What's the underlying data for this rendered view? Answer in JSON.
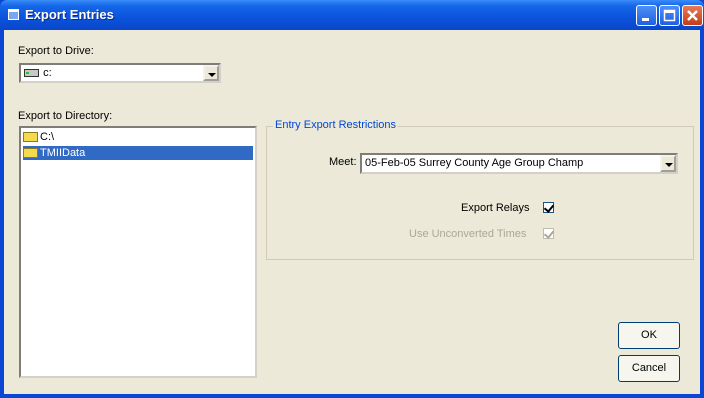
{
  "window": {
    "title": "Export Entries"
  },
  "drive": {
    "label": "Export to Drive:",
    "value": "c:"
  },
  "directory": {
    "label": "Export to Directory:",
    "items": [
      {
        "label": "C:\\"
      },
      {
        "label": "TMIIData"
      }
    ]
  },
  "restrictions": {
    "legend": "Entry Export Restrictions",
    "meet_label": "Meet:",
    "meet_value": "05-Feb-05 Surrey County Age Group Champ",
    "export_relays_label": "Export Relays",
    "export_relays_checked": true,
    "unconverted_label": "Use Unconverted Times",
    "unconverted_checked": true
  },
  "buttons": {
    "ok": "OK",
    "cancel": "Cancel"
  },
  "colors": {
    "title_bar": "#0b53dc",
    "client": "#ece9d8",
    "selection": "#316ac5",
    "legend": "#0046d5"
  }
}
